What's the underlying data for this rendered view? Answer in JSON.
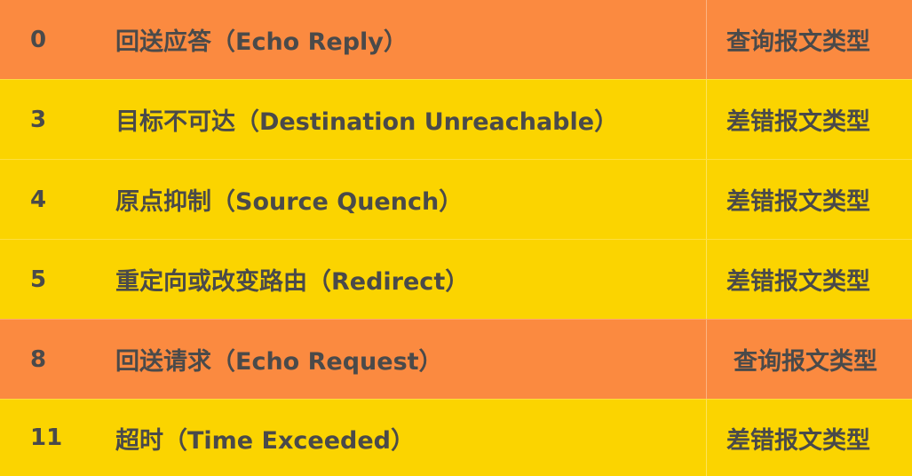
{
  "rows": [
    {
      "code": "0",
      "desc": "回送应答（Echo Reply）",
      "type": "查询报文类型"
    },
    {
      "code": "3",
      "desc": "目标不可达（Destination Unreachable）",
      "type": "差错报文类型"
    },
    {
      "code": "4",
      "desc": "原点抑制（Source Quench）",
      "type": "差错报文类型"
    },
    {
      "code": "5",
      "desc": "重定向或改变路由（Redirect）",
      "type": "差错报文类型"
    },
    {
      "code": "8",
      "desc": "回送请求（Echo Request）",
      "type": "查询报文类型"
    },
    {
      "code": "11",
      "desc": "超时（Time Exceeded）",
      "type": "差错报文类型"
    }
  ],
  "colors": {
    "query_row": "#fb8a40",
    "error_row": "#fbd400",
    "text": "#4a4a4a"
  }
}
